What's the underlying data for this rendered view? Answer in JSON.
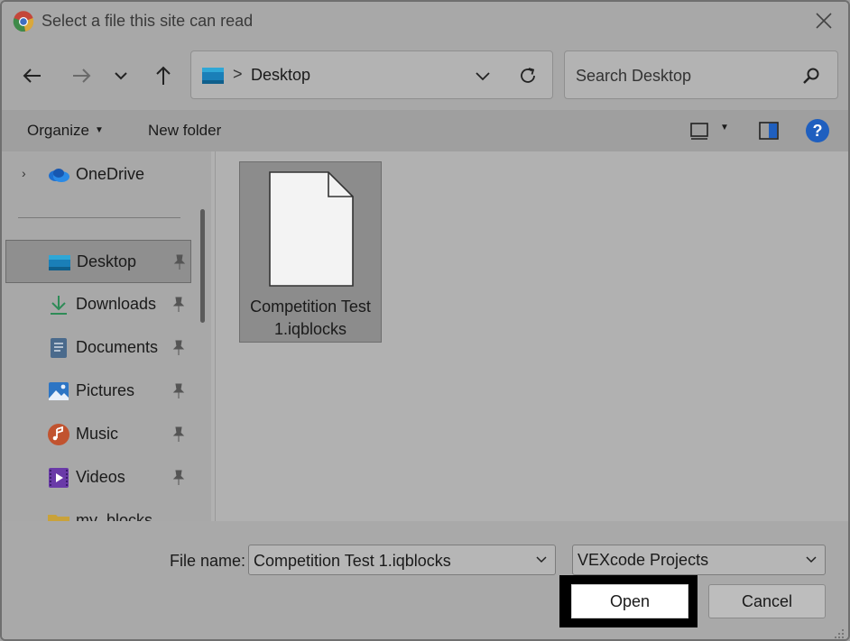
{
  "window": {
    "title": "Select a file this site can read",
    "app_icon": "chrome-icon",
    "close_icon": "close-icon"
  },
  "nav": {
    "back_icon": "arrow-left-icon",
    "forward_icon": "arrow-right-icon",
    "recent_icon": "chevron-down-icon",
    "up_icon": "arrow-up-icon",
    "address": {
      "location_icon": "desktop-icon",
      "separator": ">",
      "path": "Desktop"
    },
    "refresh_icon": "refresh-icon",
    "search": {
      "placeholder": "Search Desktop",
      "icon": "search-icon"
    }
  },
  "toolbar": {
    "organize": "Organize",
    "new_folder": "New folder",
    "view_icon": "view-layout-icon",
    "preview_pane_icon": "preview-pane-icon",
    "help_icon": "help-icon"
  },
  "sidebar": {
    "items": [
      {
        "label": "OneDrive",
        "icon": "onedrive-icon"
      },
      {
        "label": "Desktop",
        "icon": "desktop-icon",
        "pinned": true,
        "selected": true
      },
      {
        "label": "Downloads",
        "icon": "download-icon",
        "pinned": true
      },
      {
        "label": "Documents",
        "icon": "documents-icon",
        "pinned": true
      },
      {
        "label": "Pictures",
        "icon": "pictures-icon",
        "pinned": true
      },
      {
        "label": "Music",
        "icon": "music-icon",
        "pinned": true
      },
      {
        "label": "Videos",
        "icon": "videos-icon",
        "pinned": true
      },
      {
        "label": "my_blocks",
        "icon": "folder-icon"
      }
    ]
  },
  "files": [
    {
      "name": "Competition Test 1.iqblocks",
      "name_line1": "Competition Test",
      "name_line2": "1.iqblocks",
      "icon": "file-icon"
    }
  ],
  "footer": {
    "file_name_label": "File name:",
    "file_name_value": "Competition Test 1.iqblocks",
    "file_type": "VEXcode Projects",
    "open_label": "Open",
    "cancel_label": "Cancel"
  },
  "colors": {
    "help_blue": "#1f5fbf",
    "onedrive_blue": "#1e6fcf",
    "desktop_teal": "#1a7fb8"
  }
}
